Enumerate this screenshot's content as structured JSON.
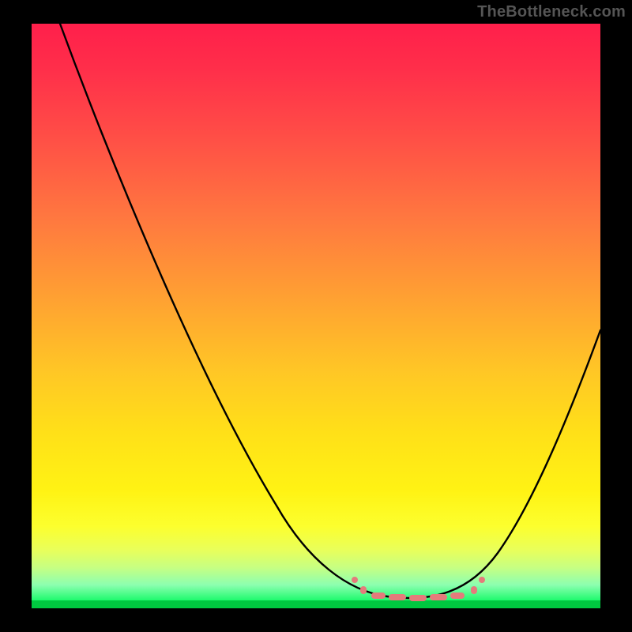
{
  "watermark": "TheBottleneck.com",
  "chart_data": {
    "type": "line",
    "title": "",
    "xlabel": "",
    "ylabel": "",
    "xlim": [
      0,
      100
    ],
    "ylim": [
      0,
      100
    ],
    "grid": false,
    "legend": false,
    "notes": "Background is a vertical red→yellow→green gradient (red = high bottleneck, green = optimal). A thin green band at y≈0 marks the ideal/no-bottleneck zone. Salmon markers between x≈56 and x≈79 highlight the flat minimum of the curve (recommended range). Axes have no visible tick labels or titles.",
    "series": [
      {
        "name": "bottleneck-curve",
        "x": [
          5,
          10,
          15,
          20,
          25,
          30,
          35,
          40,
          45,
          50,
          55,
          58,
          62,
          66,
          70,
          74,
          78,
          82,
          86,
          90,
          95,
          100
        ],
        "y": [
          100,
          91,
          82,
          72,
          62,
          52,
          42,
          33,
          25,
          17,
          10,
          6,
          3,
          2,
          1.5,
          2,
          4,
          9,
          17,
          27,
          38,
          48
        ]
      }
    ],
    "highlight_range_x": [
      56,
      79
    ],
    "color_scale": {
      "top": "#ff1f4b",
      "mid": "#ffe018",
      "bottom": "#00e44b"
    }
  }
}
